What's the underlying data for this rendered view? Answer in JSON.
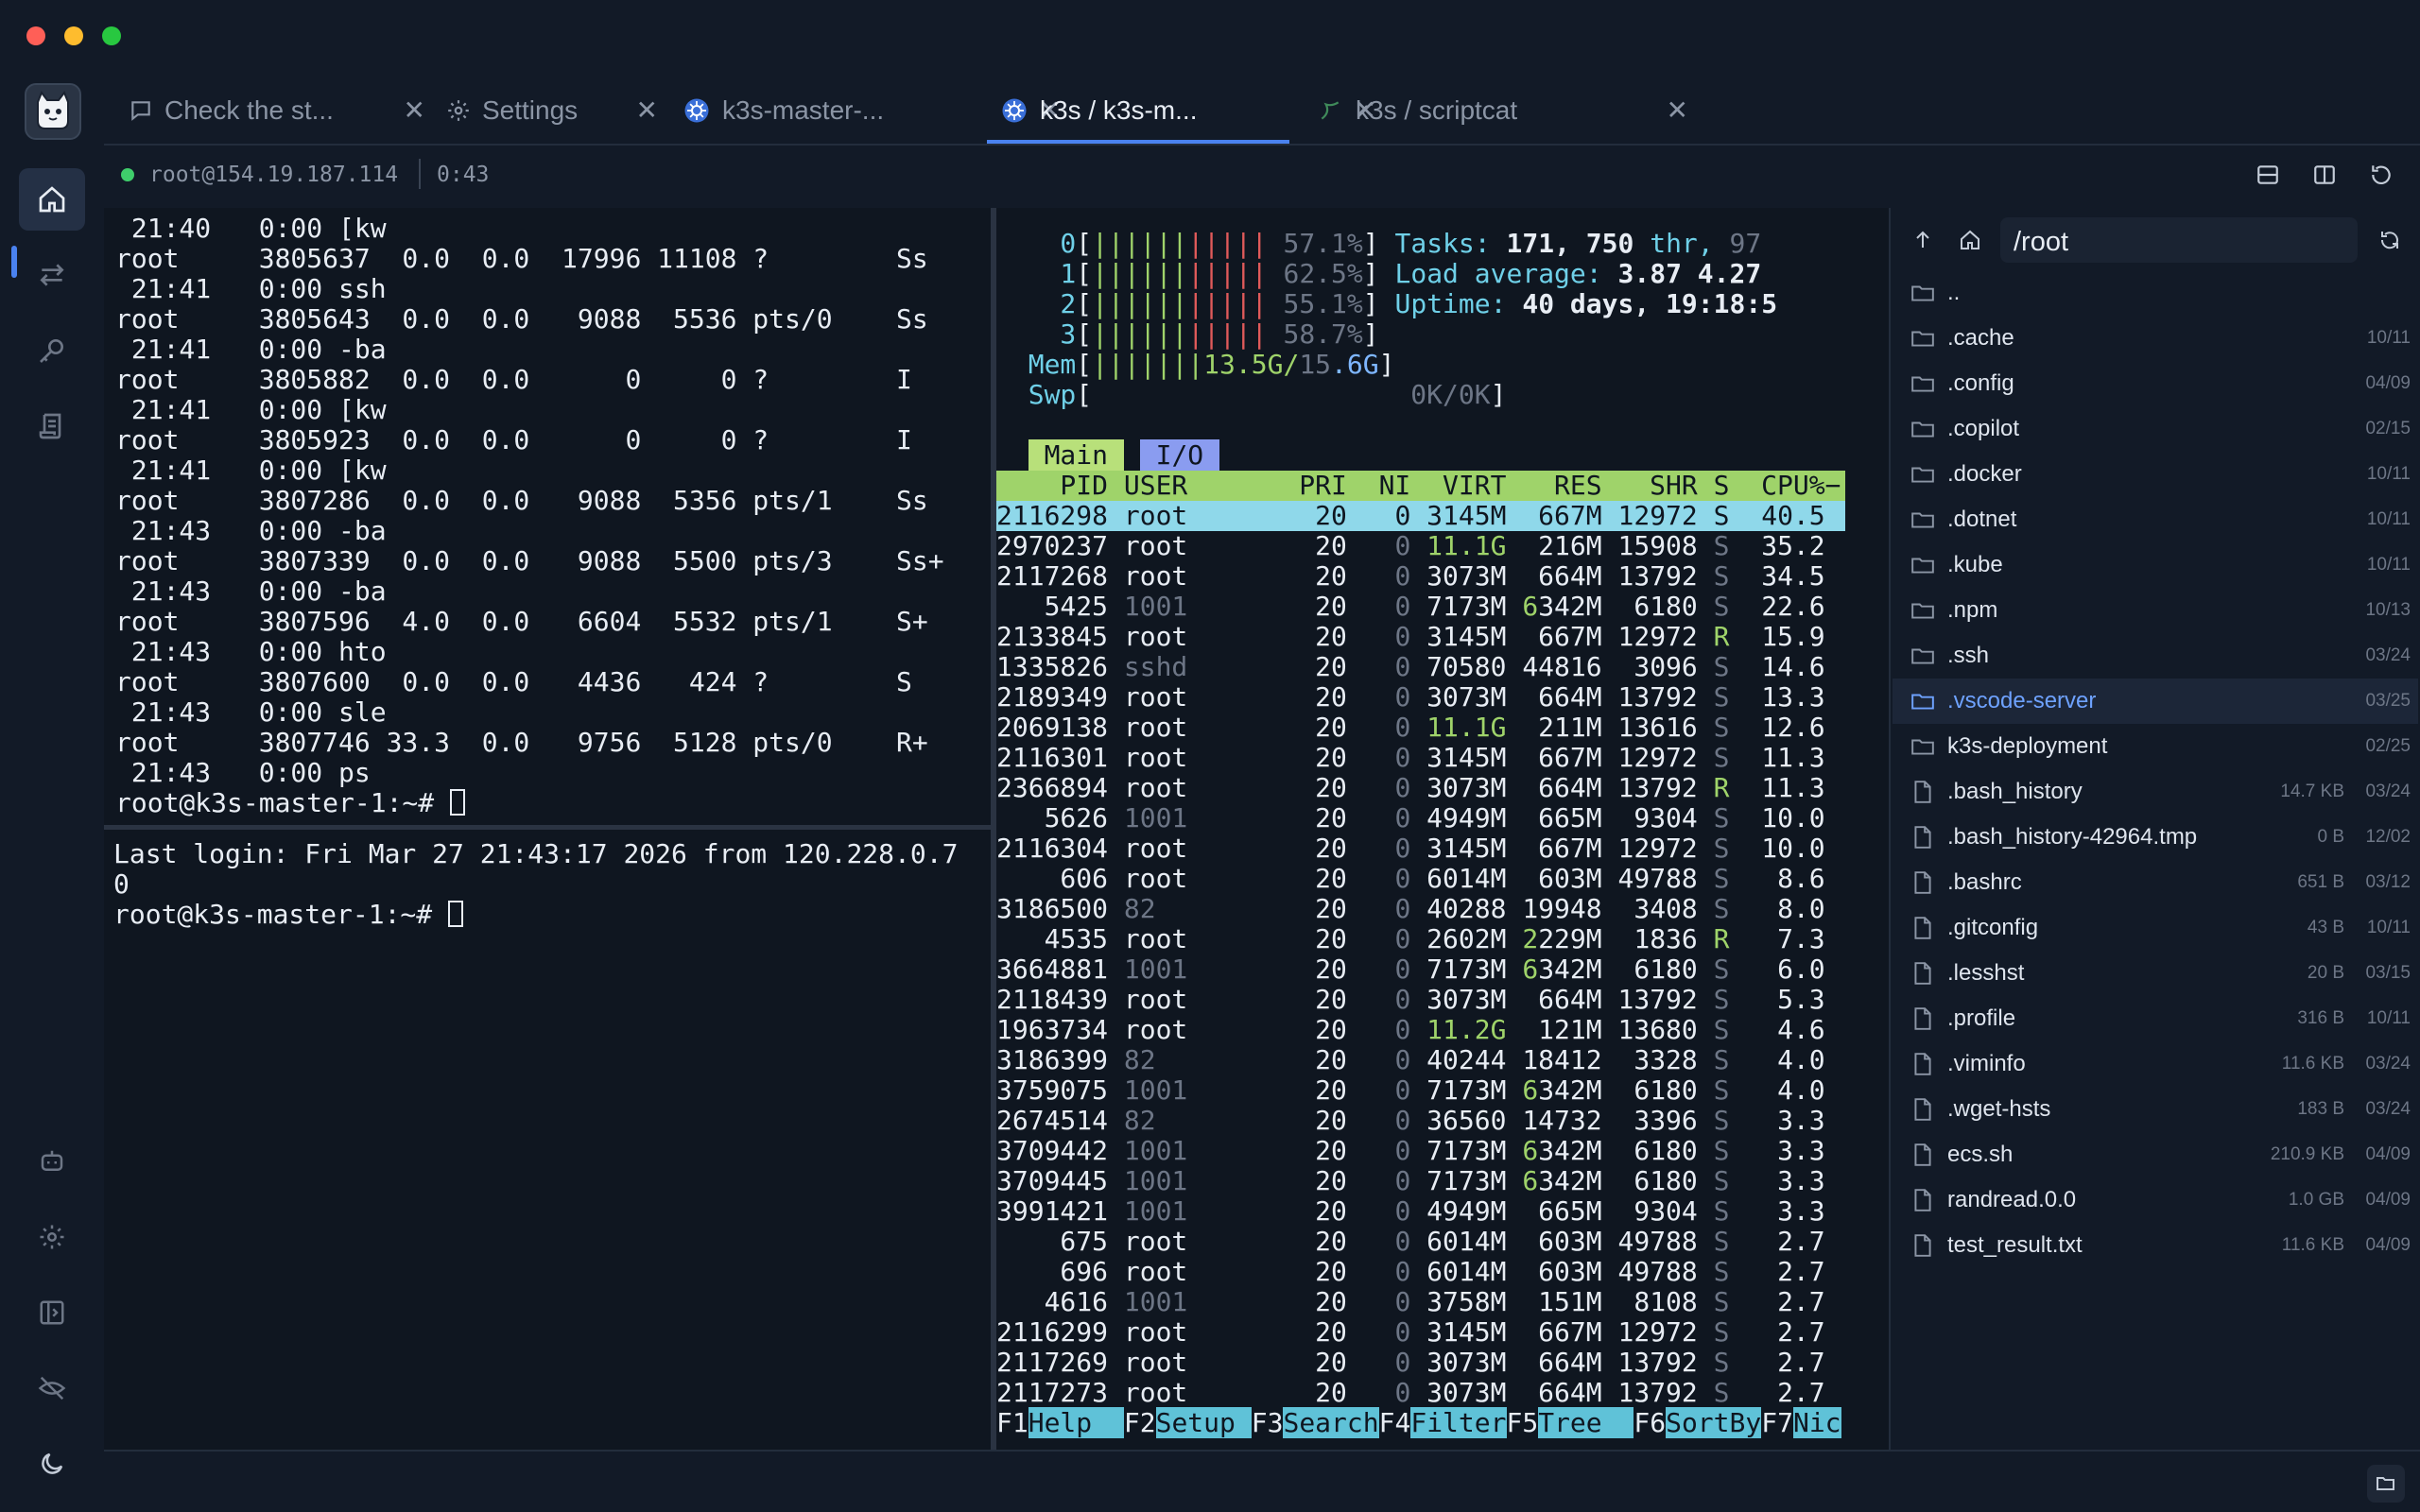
{
  "window": {
    "lights": [
      "#ff5f57",
      "#febc2e",
      "#28c840"
    ]
  },
  "tabs": [
    {
      "label": "Check the st...",
      "icon": "chat-icon",
      "active": false
    },
    {
      "label": "Settings",
      "icon": "gear-icon",
      "active": false
    },
    {
      "label": "k3s-master-...",
      "icon": "kubernetes-icon",
      "active": false
    },
    {
      "label": "k3s / k3s-m...",
      "icon": "kubernetes-icon",
      "active": true
    },
    {
      "label": "k3s / scriptcat",
      "icon": "script-icon",
      "active": false
    }
  ],
  "status": {
    "host": "root@154.19.187.114",
    "time": "0:43"
  },
  "left_terminal_top": [
    " 21:40   0:00 [kw",
    "root     3805637  0.0  0.0  17996 11108 ?        Ss",
    " 21:41   0:00 ssh",
    "root     3805643  0.0  0.0   9088  5536 pts/0    Ss",
    " 21:41   0:00 -ba",
    "root     3805882  0.0  0.0      0     0 ?        I",
    " 21:41   0:00 [kw",
    "root     3805923  0.0  0.0      0     0 ?        I",
    " 21:41   0:00 [kw",
    "root     3807286  0.0  0.0   9088  5356 pts/1    Ss",
    " 21:43   0:00 -ba",
    "root     3807339  0.0  0.0   9088  5500 pts/3    Ss+",
    " 21:43   0:00 -ba",
    "root     3807596  4.0  0.0   6604  5532 pts/1    S+",
    " 21:43   0:00 hto",
    "root     3807600  0.0  0.0   4436   424 ?        S",
    " 21:43   0:00 sle",
    "root     3807746 33.3  0.0   9756  5128 pts/0    R+",
    " 21:43   0:00 ps",
    "root@k3s-master-1:~# "
  ],
  "left_terminal_bottom": [
    "Last login: Fri Mar 27 21:43:17 2026 from 120.228.0.7",
    "0",
    "root@k3s-master-1:~# "
  ],
  "htop": {
    "cpus": [
      {
        "id": "0",
        "bar": "|||||||||||",
        "pct": "57.1%"
      },
      {
        "id": "1",
        "bar": "|||||||||||",
        "pct": "62.5%"
      },
      {
        "id": "2",
        "bar": "|||||||||||",
        "pct": "55.1%"
      },
      {
        "id": "3",
        "bar": "|||||||||||",
        "pct": "58.7%"
      }
    ],
    "cpu_values": [
      57.1,
      62.5,
      55.1,
      58.7
    ],
    "mem": {
      "bar": "|||||||",
      "value": "13.5G/15.6G"
    },
    "swp": {
      "value": "0K/0K"
    },
    "tasks": {
      "label": "Tasks:",
      "value": "171, 750",
      "thr": "thr,",
      "kthr": "97"
    },
    "load": {
      "label": "Load average:",
      "value": "3.87 4.27"
    },
    "uptime": {
      "label": "Uptime:",
      "value": "40 days, 19:18:5"
    },
    "tab_main": "Main",
    "tab_io": "I/O",
    "header": "    PID USER       PRI  NI  VIRT   RES   SHR S  CPU%−",
    "rows": [
      [
        "2116298",
        "root",
        "20",
        "0",
        "3145M",
        "667M",
        "12972",
        "S",
        "40.5"
      ],
      [
        "2970237",
        "root",
        "20",
        "0",
        "11.1G",
        "216M",
        "15908",
        "S",
        "35.2"
      ],
      [
        "2117268",
        "root",
        "20",
        "0",
        "3073M",
        "664M",
        "13792",
        "S",
        "34.5"
      ],
      [
        "5425",
        "1001",
        "20",
        "0",
        "7173M",
        "6342M",
        "6180",
        "S",
        "22.6"
      ],
      [
        "2133845",
        "root",
        "20",
        "0",
        "3145M",
        "667M",
        "12972",
        "R",
        "15.9"
      ],
      [
        "1335826",
        "sshd",
        "20",
        "0",
        "70580",
        "44816",
        "3096",
        "S",
        "14.6"
      ],
      [
        "2189349",
        "root",
        "20",
        "0",
        "3073M",
        "664M",
        "13792",
        "S",
        "13.3"
      ],
      [
        "2069138",
        "root",
        "20",
        "0",
        "11.1G",
        "211M",
        "13616",
        "S",
        "12.6"
      ],
      [
        "2116301",
        "root",
        "20",
        "0",
        "3145M",
        "667M",
        "12972",
        "S",
        "11.3"
      ],
      [
        "2366894",
        "root",
        "20",
        "0",
        "3073M",
        "664M",
        "13792",
        "R",
        "11.3"
      ],
      [
        "5626",
        "1001",
        "20",
        "0",
        "4949M",
        "665M",
        "9304",
        "S",
        "10.0"
      ],
      [
        "2116304",
        "root",
        "20",
        "0",
        "3145M",
        "667M",
        "12972",
        "S",
        "10.0"
      ],
      [
        "606",
        "root",
        "20",
        "0",
        "6014M",
        "603M",
        "49788",
        "S",
        "8.6"
      ],
      [
        "3186500",
        "82",
        "20",
        "0",
        "40288",
        "19948",
        "3408",
        "S",
        "8.0"
      ],
      [
        "4535",
        "root",
        "20",
        "0",
        "2602M",
        "2229M",
        "1836",
        "R",
        "7.3"
      ],
      [
        "3664881",
        "1001",
        "20",
        "0",
        "7173M",
        "6342M",
        "6180",
        "S",
        "6.0"
      ],
      [
        "2118439",
        "root",
        "20",
        "0",
        "3073M",
        "664M",
        "13792",
        "S",
        "5.3"
      ],
      [
        "1963734",
        "root",
        "20",
        "0",
        "11.2G",
        "121M",
        "13680",
        "S",
        "4.6"
      ],
      [
        "3186399",
        "82",
        "20",
        "0",
        "40244",
        "18412",
        "3328",
        "S",
        "4.0"
      ],
      [
        "3759075",
        "1001",
        "20",
        "0",
        "7173M",
        "6342M",
        "6180",
        "S",
        "4.0"
      ],
      [
        "2674514",
        "82",
        "20",
        "0",
        "36560",
        "14732",
        "3396",
        "S",
        "3.3"
      ],
      [
        "3709442",
        "1001",
        "20",
        "0",
        "7173M",
        "6342M",
        "6180",
        "S",
        "3.3"
      ],
      [
        "3709445",
        "1001",
        "20",
        "0",
        "7173M",
        "6342M",
        "6180",
        "S",
        "3.3"
      ],
      [
        "3991421",
        "1001",
        "20",
        "0",
        "4949M",
        "665M",
        "9304",
        "S",
        "3.3"
      ],
      [
        "675",
        "root",
        "20",
        "0",
        "6014M",
        "603M",
        "49788",
        "S",
        "2.7"
      ],
      [
        "696",
        "root",
        "20",
        "0",
        "6014M",
        "603M",
        "49788",
        "S",
        "2.7"
      ],
      [
        "4616",
        "1001",
        "20",
        "0",
        "3758M",
        "151M",
        "8108",
        "S",
        "2.7"
      ],
      [
        "2116299",
        "root",
        "20",
        "0",
        "3145M",
        "667M",
        "12972",
        "S",
        "2.7"
      ],
      [
        "2117269",
        "root",
        "20",
        "0",
        "3073M",
        "664M",
        "13792",
        "S",
        "2.7"
      ],
      [
        "2117273",
        "root",
        "20",
        "0",
        "3073M",
        "664M",
        "13792",
        "S",
        "2.7"
      ]
    ],
    "fkeys": [
      {
        "k": "F1",
        "v": "Help  "
      },
      {
        "k": "F2",
        "v": "Setup "
      },
      {
        "k": "F3",
        "v": "Search"
      },
      {
        "k": "F4",
        "v": "Filter"
      },
      {
        "k": "F5",
        "v": "Tree  "
      },
      {
        "k": "F6",
        "v": "SortBy"
      },
      {
        "k": "F7",
        "v": "Nic"
      }
    ]
  },
  "files": {
    "path": "/root",
    "items": [
      {
        "name": "..",
        "type": "folder",
        "size": "",
        "date": ""
      },
      {
        "name": ".cache",
        "type": "folder",
        "size": "",
        "date": "10/11"
      },
      {
        "name": ".config",
        "type": "folder",
        "size": "",
        "date": "04/09"
      },
      {
        "name": ".copilot",
        "type": "folder",
        "size": "",
        "date": "02/15"
      },
      {
        "name": ".docker",
        "type": "folder",
        "size": "",
        "date": "10/11"
      },
      {
        "name": ".dotnet",
        "type": "folder",
        "size": "",
        "date": "10/11"
      },
      {
        "name": ".kube",
        "type": "folder",
        "size": "",
        "date": "10/11"
      },
      {
        "name": ".npm",
        "type": "folder",
        "size": "",
        "date": "10/13"
      },
      {
        "name": ".ssh",
        "type": "folder",
        "size": "",
        "date": "03/24"
      },
      {
        "name": ".vscode-server",
        "type": "folder",
        "size": "",
        "date": "03/25",
        "selected": true
      },
      {
        "name": "k3s-deployment",
        "type": "folder",
        "size": "",
        "date": "02/25"
      },
      {
        "name": ".bash_history",
        "type": "file",
        "size": "14.7 KB",
        "date": "03/24"
      },
      {
        "name": ".bash_history-42964.tmp",
        "type": "file",
        "size": "0 B",
        "date": "12/02"
      },
      {
        "name": ".bashrc",
        "type": "file",
        "size": "651 B",
        "date": "03/12"
      },
      {
        "name": ".gitconfig",
        "type": "file",
        "size": "43 B",
        "date": "10/11"
      },
      {
        "name": ".lesshst",
        "type": "file",
        "size": "20 B",
        "date": "03/15"
      },
      {
        "name": ".profile",
        "type": "file",
        "size": "316 B",
        "date": "10/11"
      },
      {
        "name": ".viminfo",
        "type": "file",
        "size": "11.6 KB",
        "date": "03/24"
      },
      {
        "name": ".wget-hsts",
        "type": "file",
        "size": "183 B",
        "date": "03/24"
      },
      {
        "name": "ecs.sh",
        "type": "file",
        "size": "210.9 KB",
        "date": "04/09"
      },
      {
        "name": "randread.0.0",
        "type": "file",
        "size": "1.0 GB",
        "date": "04/09"
      },
      {
        "name": "test_result.txt",
        "type": "file",
        "size": "11.6 KB",
        "date": "04/09"
      }
    ]
  },
  "colors": {
    "accent": "#4a82f0",
    "status_online": "#3fce6b",
    "selected_file": "#6ea2ff"
  }
}
